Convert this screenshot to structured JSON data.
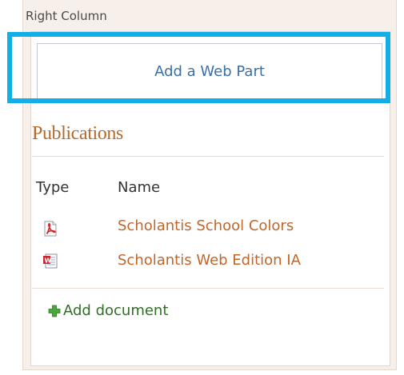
{
  "zone": {
    "title": "Right Column",
    "add_webpart_label": "Add a Web Part"
  },
  "webpart": {
    "title": "Publications",
    "columns": [
      "Type",
      "Name"
    ],
    "documents": [
      {
        "type_icon": "pdf-icon",
        "name": "Scholantis School Colors"
      },
      {
        "type_icon": "word-document-icon",
        "name": "Scholantis Web Edition IA"
      }
    ],
    "add_document_label": "Add document"
  },
  "colors": {
    "highlight": "#12aee8",
    "link": "#c0662b",
    "title": "#b56a2a",
    "add_document": "#2f6e24"
  }
}
